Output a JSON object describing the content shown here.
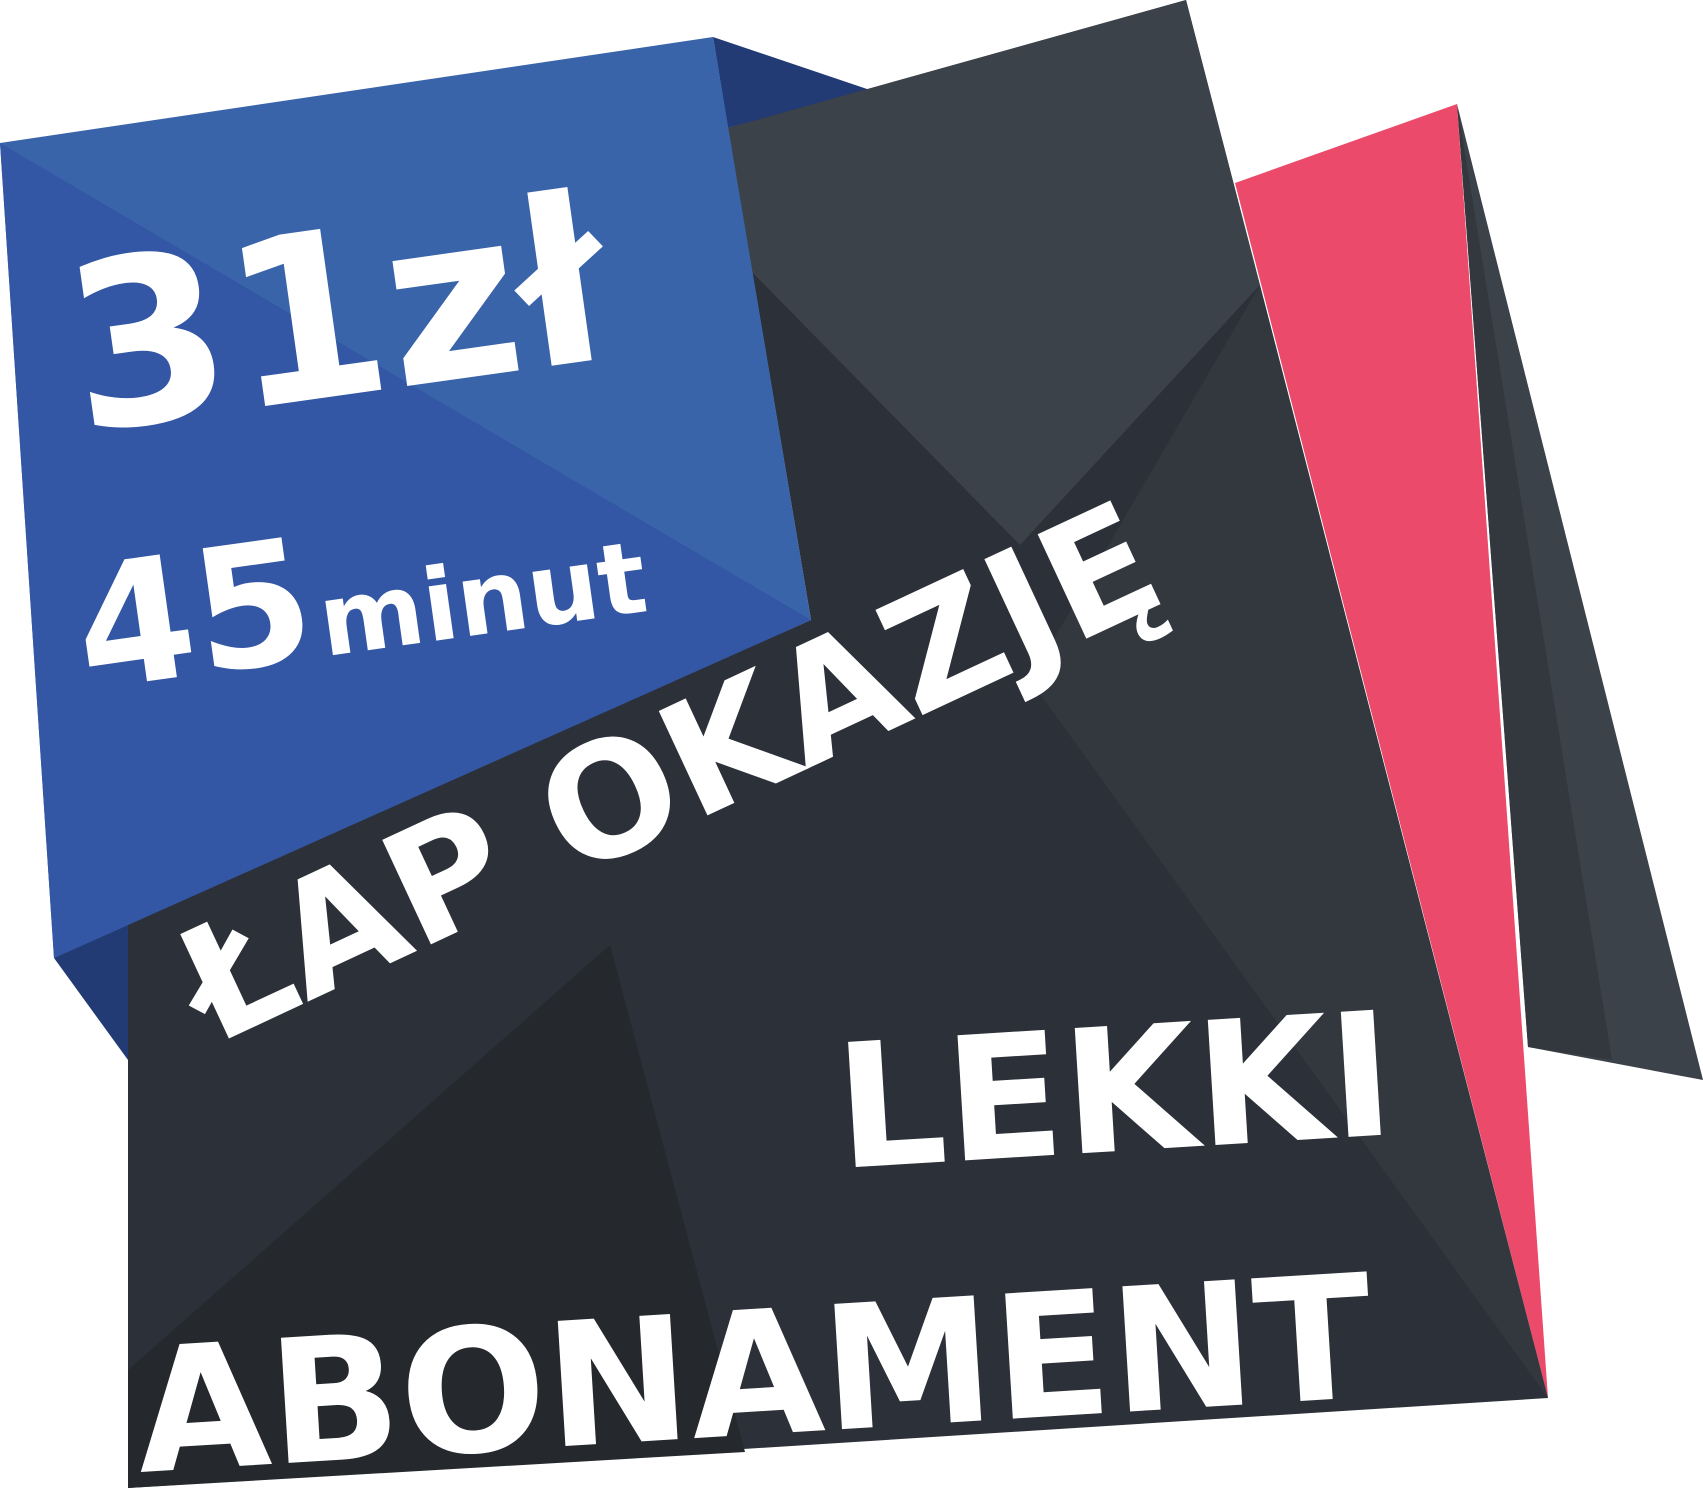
{
  "price": {
    "amount": "31zł"
  },
  "duration": {
    "number": "45",
    "unit": "minut"
  },
  "promo": {
    "tagline": "ŁAP OKAZJĘ",
    "title_line_1": "LEKKI",
    "title_line_2": "ABONAMENT"
  },
  "colors": {
    "blue_panel": "#3964AA",
    "blue_shade": "#3356A5",
    "blue_dark": "#233B75",
    "dark_panel": "#2C3038",
    "dark_mid": "#3C4249",
    "dark_deep": "#25292D",
    "pink_panel": "#EC4A6B",
    "text": "#FFFFFF"
  }
}
